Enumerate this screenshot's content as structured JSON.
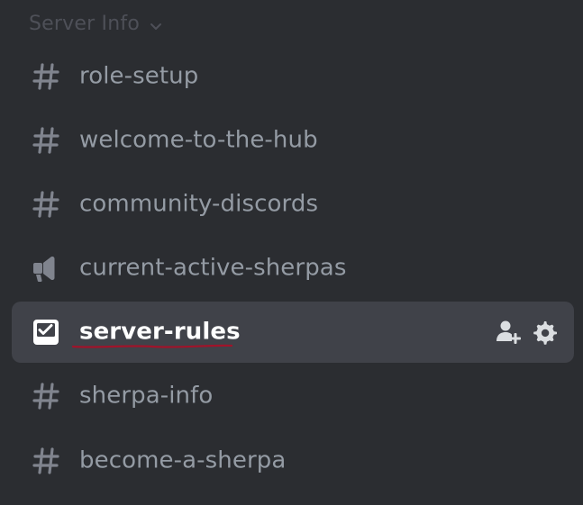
{
  "category": {
    "label": "Server Info",
    "icon": "chevron-down-icon"
  },
  "channels": [
    {
      "name": "role-setup",
      "type": "text",
      "icon": "hash-icon"
    },
    {
      "name": "welcome-to-the-hub",
      "type": "text",
      "icon": "hash-icon"
    },
    {
      "name": "community-discords",
      "type": "text",
      "icon": "hash-icon"
    },
    {
      "name": "current-active-sherpas",
      "type": "announcement",
      "icon": "megaphone-icon"
    },
    {
      "name": "server-rules",
      "type": "rules",
      "icon": "rules-icon",
      "selected": true
    },
    {
      "name": "sherpa-info",
      "type": "text",
      "icon": "hash-icon"
    },
    {
      "name": "become-a-sherpa",
      "type": "text",
      "icon": "hash-icon"
    }
  ],
  "selected_actions": {
    "invite_icon": "add-member-icon",
    "settings_icon": "gear-icon"
  },
  "colors": {
    "background": "#2b2d31",
    "selected_background": "#404249",
    "channel_text": "#949ba4",
    "selected_text": "#ffffff",
    "category_text": "#4e5058",
    "spellcheck_underline": "#a0132a"
  }
}
